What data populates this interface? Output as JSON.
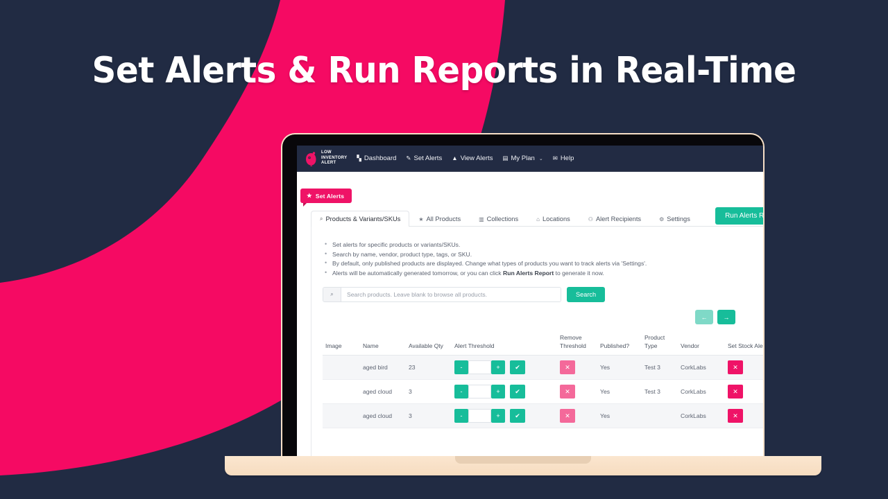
{
  "colors": {
    "background_navy": "#212b43",
    "accent_pink": "#f50a63",
    "accent_teal": "#17bd9a",
    "badge_pink": "#ef1367",
    "remove_pink": "#f4699a"
  },
  "hero": {
    "headline": "Set Alerts & Run Reports in Real-Time"
  },
  "app": {
    "brand": {
      "icon": "owl-logo-icon",
      "name": "LOW\nINVENTORY\nALERT"
    },
    "nav": [
      {
        "icon": "dashboard-grid-icon",
        "glyph": "▚",
        "label": "Dashboard"
      },
      {
        "icon": "pencil-icon",
        "glyph": "✎",
        "label": "Set Alerts"
      },
      {
        "icon": "warning-triangle-icon",
        "glyph": "▲",
        "label": "View Alerts"
      },
      {
        "icon": "card-icon",
        "glyph": "▤",
        "label": "My Plan",
        "caret": "⌄"
      },
      {
        "icon": "envelope-icon",
        "glyph": "✉",
        "label": "Help"
      }
    ],
    "page_badge": {
      "icon": "star-icon",
      "glyph": "★",
      "label": "Set Alerts"
    },
    "tabs": [
      {
        "icon": "search-icon",
        "glyph": "⌕",
        "label": "Products & Variants/SKUs",
        "active": true
      },
      {
        "icon": "star-icon",
        "glyph": "★",
        "label": "All Products",
        "active": false
      },
      {
        "icon": "collections-grid-icon",
        "glyph": "▥",
        "label": "Collections",
        "active": false
      },
      {
        "icon": "home-icon",
        "glyph": "⌂",
        "label": "Locations",
        "active": false
      },
      {
        "icon": "people-icon",
        "glyph": "⚇",
        "label": "Alert Recipients",
        "active": false
      },
      {
        "icon": "gear-icon",
        "glyph": "⚙",
        "label": "Settings",
        "active": false
      }
    ],
    "run_alerts_button": "Run Alerts Report",
    "tips": [
      "Set alerts for specific products or variants/SKUs.",
      "Search by name, vendor, product type, tags, or SKU.",
      "By default, only published products are displayed. Change what types of products you want to track alerts via 'Settings'.",
      "Alerts will be automatically generated tomorrow, or you can click Run Alerts Report to generate it now."
    ],
    "tips_bold_phrase": "Run Alerts Report",
    "search": {
      "icon": "search-icon",
      "glyph": "⌕",
      "value": "",
      "placeholder": "Search products. Leave blank to browse all products.",
      "button_label": "Search"
    },
    "pager": {
      "prev_glyph": "←",
      "next_glyph": "→",
      "prev_label": "Previous page",
      "next_label": "Next page"
    },
    "table": {
      "columns": [
        "Image",
        "Name",
        "Available Qty",
        "Alert Threshold",
        "Remove Threshold",
        "Published?",
        "Product Type",
        "Vendor",
        "Set Stock Alert"
      ],
      "controls": {
        "minus": "-",
        "plus": "+",
        "confirm": "✔",
        "remove": "✕",
        "set_alert": "✕"
      },
      "rows": [
        {
          "image": "",
          "name": "aged bird",
          "available_qty": "23",
          "threshold_value": "",
          "published": "Yes",
          "product_type": "Test 3",
          "vendor": "CorkLabs"
        },
        {
          "image": "",
          "name": "aged cloud",
          "available_qty": "3",
          "threshold_value": "",
          "published": "Yes",
          "product_type": "Test 3",
          "vendor": "CorkLabs"
        },
        {
          "image": "",
          "name": "aged cloud",
          "available_qty": "3",
          "threshold_value": "",
          "published": "Yes",
          "product_type": "",
          "vendor": "CorkLabs"
        }
      ]
    }
  }
}
